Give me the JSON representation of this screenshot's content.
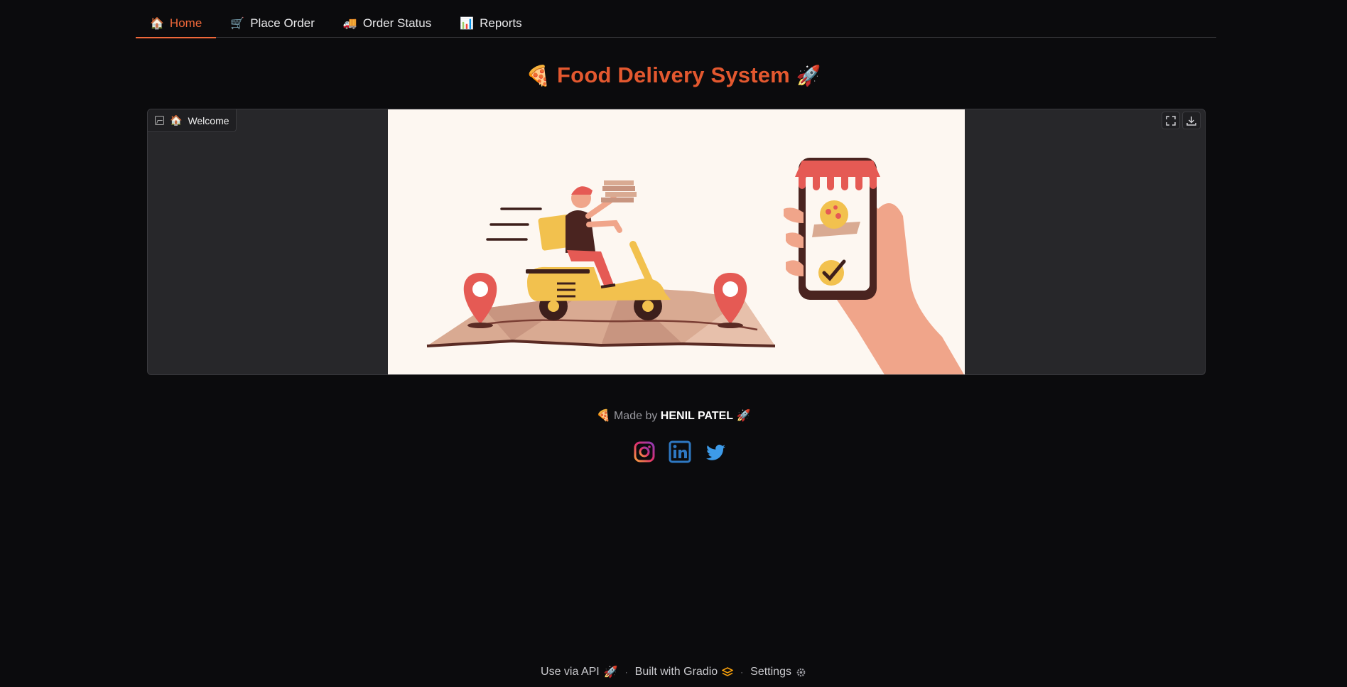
{
  "tabs": [
    {
      "icon": "🏠",
      "label": "Home",
      "active": true
    },
    {
      "icon": "🛒",
      "label": "Place Order",
      "active": false
    },
    {
      "icon": "🚚",
      "label": "Order Status",
      "active": false
    },
    {
      "icon": "📊",
      "label": "Reports",
      "active": false
    }
  ],
  "header": {
    "left_emoji": "🍕",
    "title": "Food Delivery System",
    "right_emoji": "🚀"
  },
  "image_panel": {
    "label_icon": "🏠",
    "label": "Welcome",
    "tools": [
      "fullscreen-icon",
      "download-icon"
    ]
  },
  "credit": {
    "left_emoji": "🍕",
    "prefix": "Made by",
    "name": "HENIL PATEL",
    "right_emoji": "🚀"
  },
  "socials": [
    "instagram-icon",
    "linkedin-icon",
    "twitter-icon"
  ],
  "footer": {
    "api_label": "Use via API",
    "api_emoji": "🚀",
    "built_label": "Built with Gradio",
    "settings_label": "Settings"
  },
  "colors": {
    "accent": "#e3582f",
    "tab_active": "#f0683a",
    "background": "#0b0b0d",
    "panel": "#27272a"
  }
}
